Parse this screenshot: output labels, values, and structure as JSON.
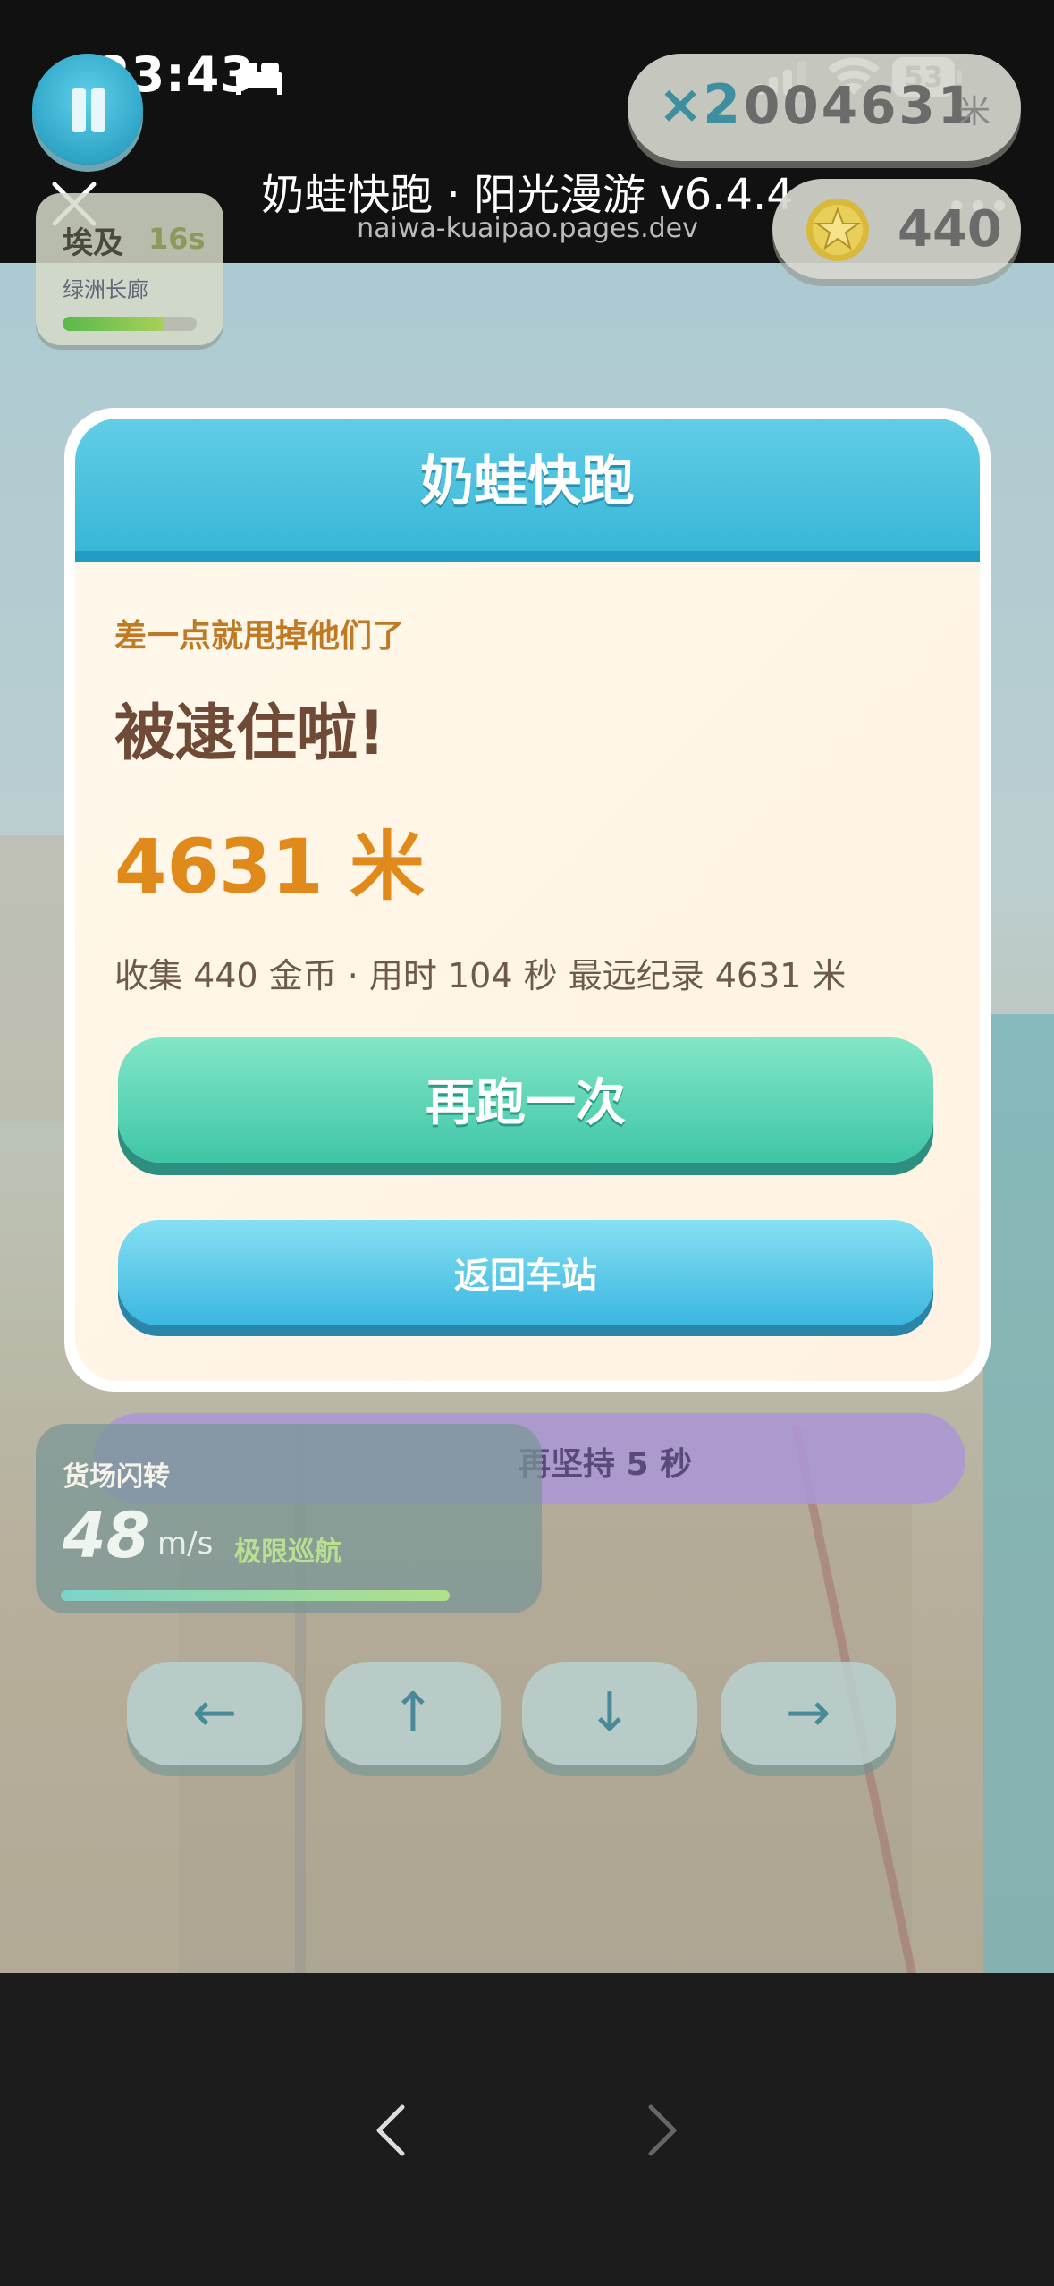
{
  "status_bar": {
    "time": "23:43",
    "battery": "53"
  },
  "browser": {
    "title": "奶蛙快跑 · 阳光漫游 v6.4.4",
    "url": "naiwa-kuaipao.pages.dev"
  },
  "hud": {
    "zone_name": "埃及",
    "zone_time": "16s",
    "zone_subtitle": "绿洲长廊",
    "zone_progress": 0.75,
    "multiplier": "×2",
    "score": "004631",
    "score_unit": "米",
    "coins": "440"
  },
  "modal": {
    "title": "奶蛙快跑",
    "subtitle": "差一点就甩掉他们了",
    "headline": "被逮住啦!",
    "distance": "4631 米",
    "stats": "收集 440 金币 · 用时 104 秒 最远纪录 4631 米",
    "retry_label": "再跑一次",
    "home_label": "返回车站"
  },
  "hint_text": "再坚持 5 秒",
  "speed_panel": {
    "title": "货场闪转",
    "speed": "48",
    "unit": "m/s",
    "mode": "极限巡航",
    "progress": 0.85
  },
  "controls": {
    "left": "←",
    "up": "↑",
    "down": "↓",
    "right": "→"
  },
  "colors": {
    "accent": "#34b5d6",
    "retry": "#3ec6a6",
    "distance": "#e08a1c"
  }
}
